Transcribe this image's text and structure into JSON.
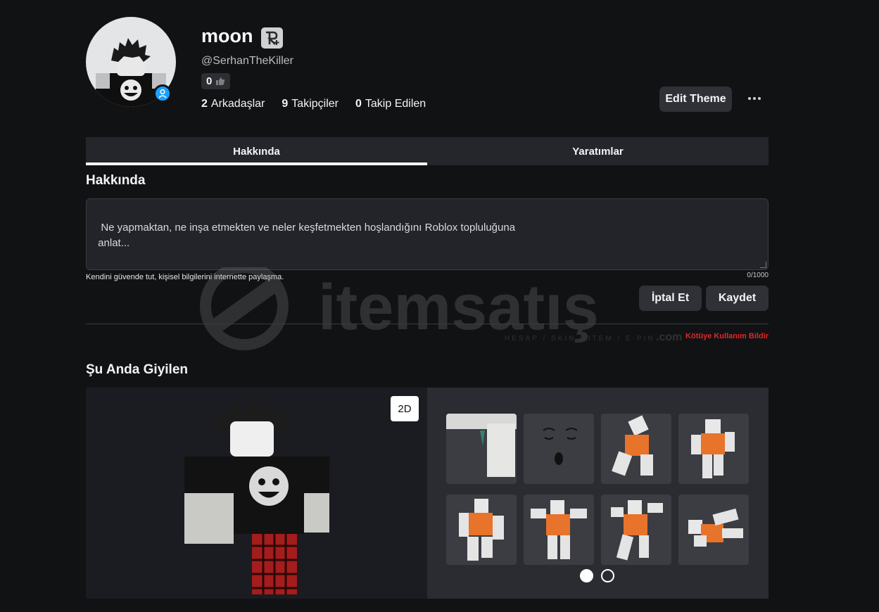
{
  "profile": {
    "display_name": "moon",
    "username": "@SerhanTheKiller",
    "likes": "0",
    "stats": [
      {
        "count": "2",
        "label": "Arkadaşlar"
      },
      {
        "count": "9",
        "label": "Takipçiler"
      },
      {
        "count": "0",
        "label": "Takip Edilen"
      }
    ]
  },
  "header": {
    "edit_theme_label": "Edit Theme"
  },
  "tabs": [
    {
      "label": "Hakkında",
      "active": true
    },
    {
      "label": "Yaratımlar",
      "active": false
    }
  ],
  "about": {
    "heading": "Hakkında",
    "placeholder": "Ne yapmaktan, ne inşa etmekten ve neler keşfetmekten hoşlandığını Roblox topluluğuna\n anlat...",
    "safety_note": "Kendini güvende tut, kişisel bilgilerini internette paylaşma.",
    "char_count": "0/1000",
    "cancel_label": "İptal Et",
    "save_label": "Kaydet",
    "report_label": "Kötüye Kullanım Bildir"
  },
  "watermark": {
    "brand": "itemsatış",
    "tagline": "HESAP / SKIN / ITEM / E-PIN",
    "domain": ".com"
  },
  "wearing": {
    "heading": "Şu Anda Giyilen",
    "toggle_label": "2D",
    "items": [
      {
        "name": "hair-accessory-icon"
      },
      {
        "name": "face-icon"
      },
      {
        "name": "emote-animation-icon"
      },
      {
        "name": "emote-animation-icon"
      },
      {
        "name": "emote-animation-icon"
      },
      {
        "name": "emote-animation-icon"
      },
      {
        "name": "emote-animation-icon"
      },
      {
        "name": "emote-animation-icon"
      }
    ],
    "pages": 2,
    "current_page": 1
  },
  "colors": {
    "background": "#111214",
    "surface": "#24262b",
    "button": "#2f3136",
    "online_badge": "#1aa0ff",
    "report_red": "#e0262b",
    "shirt_orange": "#e8732a"
  }
}
